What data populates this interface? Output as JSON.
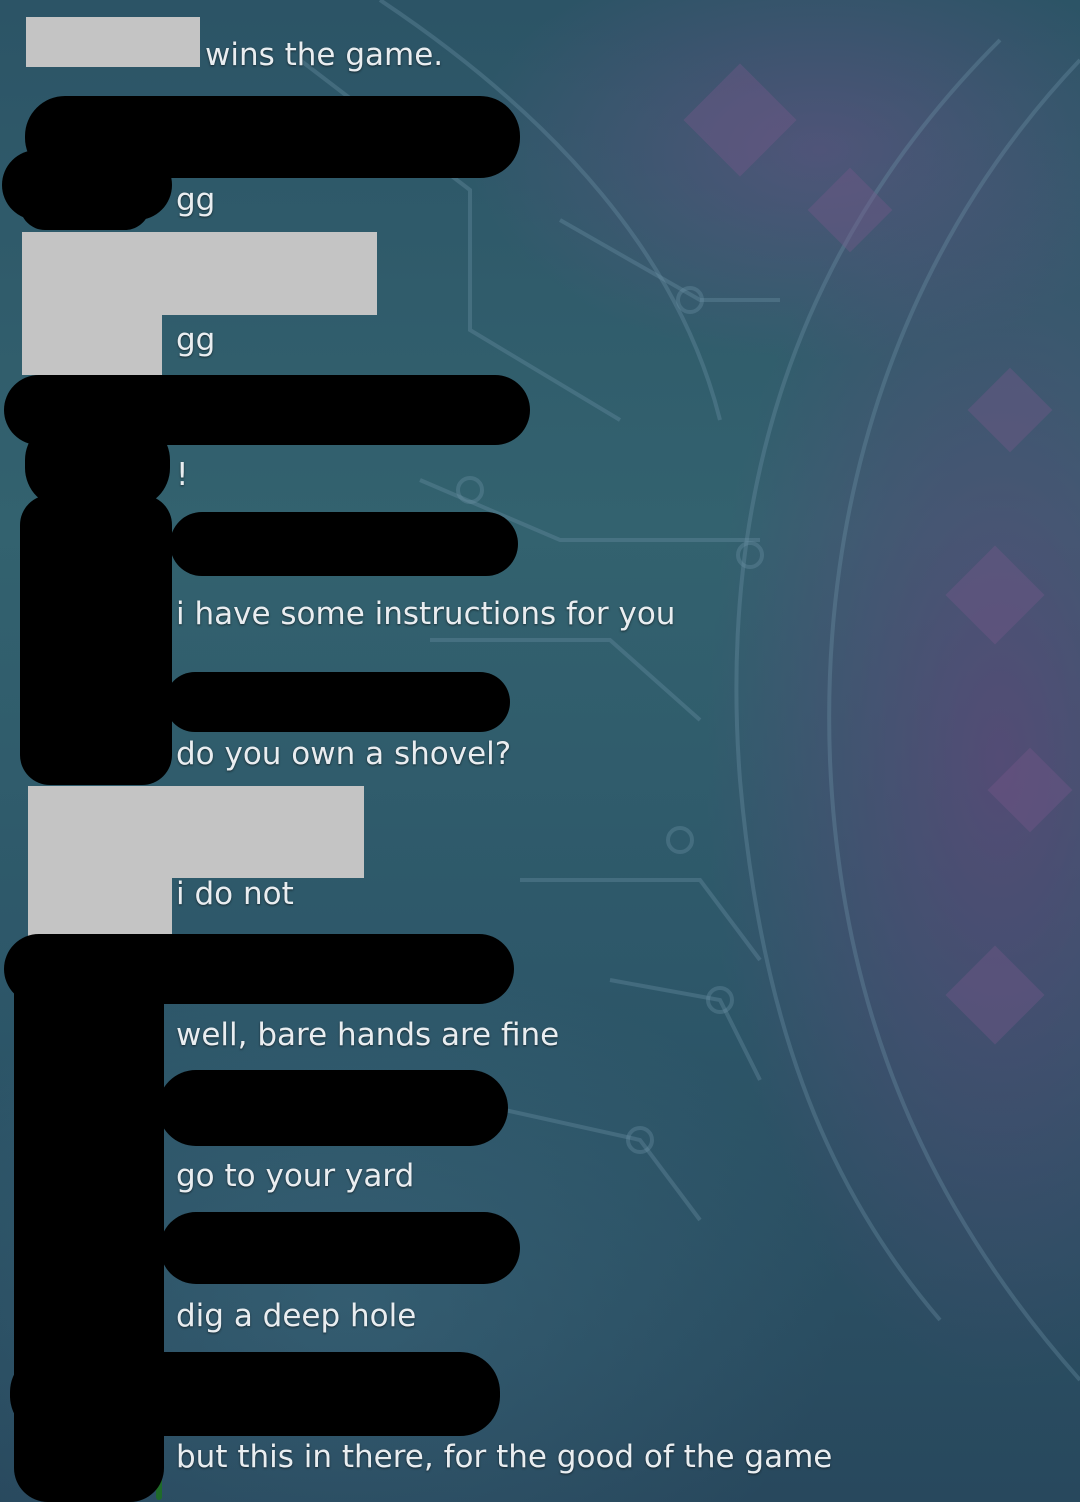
{
  "chat": {
    "messages": [
      {
        "author_redacted": true,
        "text": "wins the game."
      },
      {
        "author_redacted": true,
        "text": "gg"
      },
      {
        "author_redacted": true,
        "text": "gg"
      },
      {
        "author_redacted": true,
        "text": "!"
      },
      {
        "author_redacted": true,
        "text": "i have some instructions for you"
      },
      {
        "author_redacted": true,
        "text": "do you own a shovel?"
      },
      {
        "author_redacted": true,
        "text": "i do not"
      },
      {
        "author_redacted": true,
        "text": "well, bare hands are fine"
      },
      {
        "author_redacted": true,
        "text": "go to your yard"
      },
      {
        "author_redacted": true,
        "text": "dig a deep hole"
      },
      {
        "author_redacted": true,
        "text": "but this in there, for the good of the game"
      }
    ]
  },
  "colors": {
    "background": "#2d5769",
    "text": "#e9edf0",
    "redaction_box": "#c4c4c4",
    "redaction_scribble": "#000000"
  }
}
